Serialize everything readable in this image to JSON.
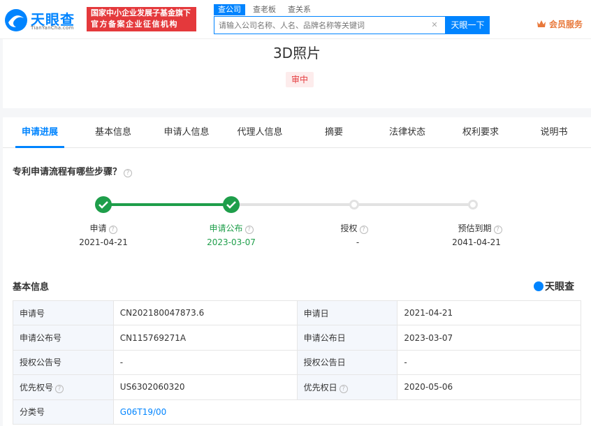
{
  "header": {
    "logo_text": "天眼查",
    "logo_sub": "TianYanCha.com",
    "badge_line1": "国家中小企业发展子基金旗下",
    "badge_line2": "官方备案企业征信机构",
    "search_tabs": [
      "查公司",
      "查老板",
      "查关系"
    ],
    "search_placeholder": "请输入公司名称、人名、品牌名称等关键词",
    "search_button": "天眼一下",
    "member_label": "会员服务"
  },
  "title_card": {
    "title": "3D照片",
    "status": "审中"
  },
  "tabs": [
    "申请进展",
    "基本信息",
    "申请人信息",
    "代理人信息",
    "摘要",
    "法律状态",
    "权利要求",
    "说明书"
  ],
  "progress": {
    "heading": "专利申请流程有哪些步骤？",
    "steps": [
      {
        "label": "申请",
        "date": "2021-04-21",
        "done": true
      },
      {
        "label": "申请公布",
        "date": "2023-03-07",
        "done": true
      },
      {
        "label": "授权",
        "date": "-",
        "done": false
      },
      {
        "label": "预估到期",
        "date": "2041-04-21",
        "done": false
      }
    ]
  },
  "basic_info": {
    "heading": "基本信息",
    "brand": "天眼查",
    "rows": [
      {
        "k1": "申请号",
        "v1": "CN202180047873.6",
        "k2": "申请日",
        "v2": "2021-04-21"
      },
      {
        "k1": "申请公布号",
        "v1": "CN115769271A",
        "k2": "申请公布日",
        "v2": "2023-03-07"
      },
      {
        "k1": "授权公告号",
        "v1": "-",
        "k2": "授权公告日",
        "v2": "-"
      },
      {
        "k1": "优先权号",
        "v1": "US6302060320",
        "k2": "优先权日",
        "v2": "2020-05-06"
      },
      {
        "k1": "分类号",
        "v1": "G06T19/00"
      }
    ]
  },
  "colors": {
    "accent": "#0084ff",
    "done": "#1e9e4a",
    "status_red": "#e4393c"
  }
}
